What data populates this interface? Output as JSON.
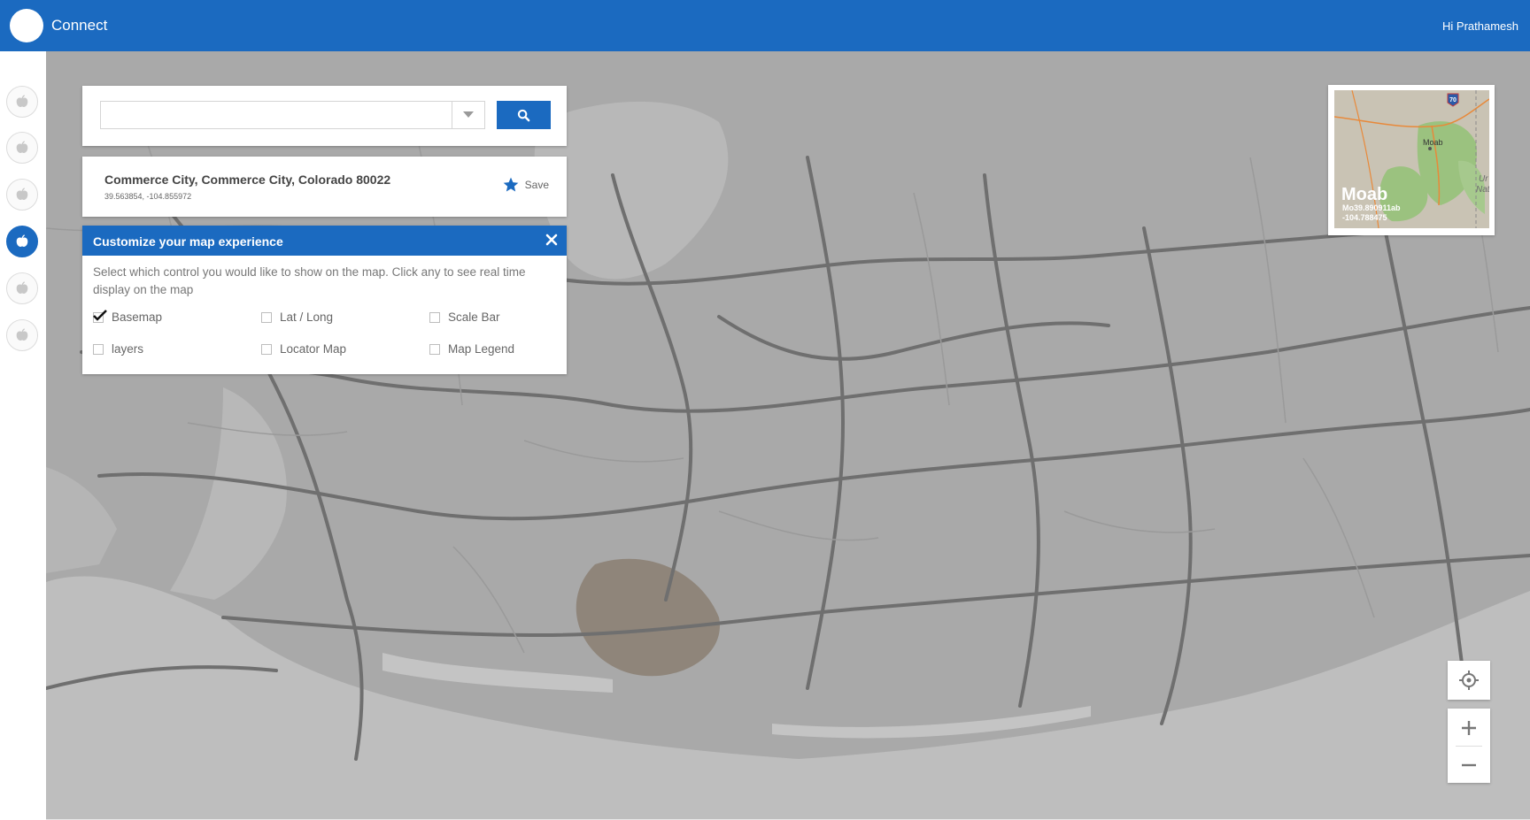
{
  "header": {
    "app_title": "Connect",
    "greeting": "Hi Prathamesh"
  },
  "sidebar": {
    "items": [
      {
        "icon": "apple-icon",
        "active": false
      },
      {
        "icon": "apple-icon",
        "active": false
      },
      {
        "icon": "apple-icon",
        "active": false
      },
      {
        "icon": "apple-icon",
        "active": true
      },
      {
        "icon": "apple-icon",
        "active": false
      },
      {
        "icon": "apple-icon",
        "active": false
      }
    ]
  },
  "search": {
    "value": "",
    "placeholder": ""
  },
  "result": {
    "title": "Commerce City, Commerce City, Colorado 80022",
    "coords": "39.563854, -104.855972",
    "save_label": "Save"
  },
  "customize": {
    "title": "Customize your map experience",
    "description": "Select which control you would like to show on the map. Click any to see real time display on the map",
    "options": [
      {
        "label": "Basemap",
        "checked": true
      },
      {
        "label": "Lat / Long",
        "checked": false
      },
      {
        "label": "Scale Bar",
        "checked": false
      },
      {
        "label": "layers",
        "checked": false
      },
      {
        "label": "Locator Map",
        "checked": false
      },
      {
        "label": "Map Legend",
        "checked": false
      }
    ]
  },
  "locator": {
    "name": "Moab",
    "coord_line1": "Mo39.890911ab",
    "coord_line2": "-104.788475",
    "map_label": "Moab",
    "highway": "70",
    "edge_text": "Ur\nNat"
  },
  "colors": {
    "brand": "#1b6ac0",
    "map_bg": "#a9a9a9",
    "road": "#6f6f6f"
  }
}
